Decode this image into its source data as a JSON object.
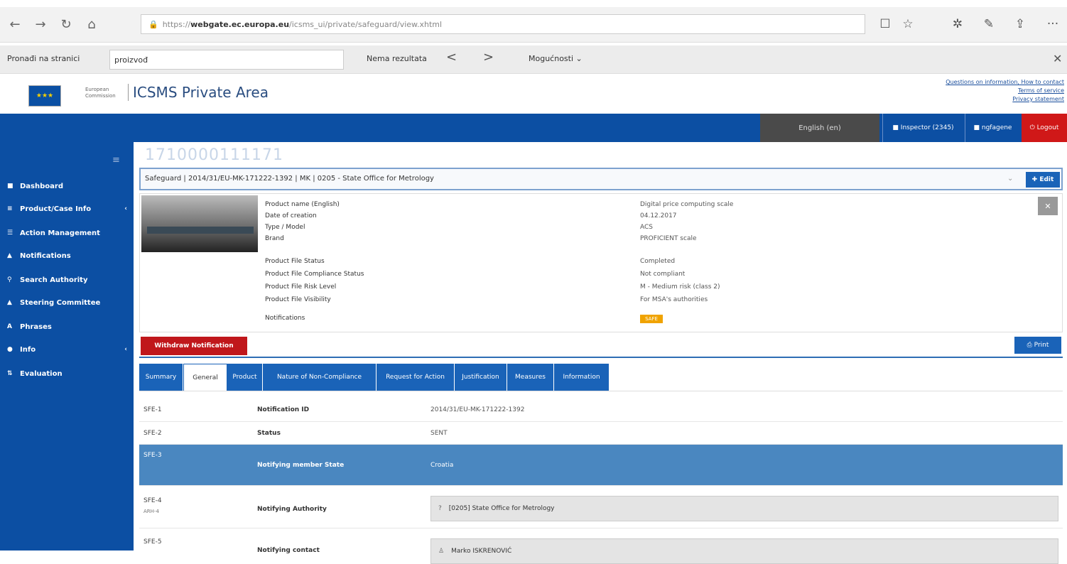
{
  "browser": {
    "back": "←",
    "forward": "→",
    "refresh": "↻",
    "home": "⌂",
    "url_prefix": "https://",
    "url_domain": "webgate.ec.europa.eu",
    "url_rest": "/icsms_ui/private/safeguard/view.xhtml",
    "reading_view": "☐",
    "favorite": "☆",
    "favorites_list": "✲",
    "notes": "✎",
    "share": "⇪",
    "more": "···"
  },
  "findbar": {
    "label": "Pronađi na stranici",
    "query": "proizvođ",
    "result": "Nema rezultata",
    "prev": "<",
    "next": ">",
    "options": "Mogućnosti ⌄",
    "close": "✕"
  },
  "header": {
    "ec_text": "European Commission",
    "title": "ICSMS Private Area",
    "links": [
      "Questions on information, How to contact",
      "Terms of service",
      "Privacy statement"
    ]
  },
  "topnav": {
    "language": "English (en)",
    "org": "■ Inspector (2345)",
    "user": "■ ngfagene",
    "logout": "⏻ Logout"
  },
  "sidebar": {
    "toggle": "≡",
    "items": [
      {
        "icon": "■",
        "label": "Dashboard",
        "chevron": ""
      },
      {
        "icon": "≡",
        "label": "Product/Case Info",
        "chevron": "‹"
      },
      {
        "icon": "☰",
        "label": "Action Management",
        "chevron": ""
      },
      {
        "icon": "▲",
        "label": "Notifications",
        "chevron": ""
      },
      {
        "icon": "⚲",
        "label": "Search Authority",
        "chevron": ""
      },
      {
        "icon": "▲",
        "label": "Steering Committee",
        "chevron": ""
      },
      {
        "icon": "A",
        "label": "Phrases",
        "chevron": ""
      },
      {
        "icon": "●",
        "label": "Info",
        "chevron": "‹"
      },
      {
        "icon": "⇅",
        "label": "Evaluation",
        "chevron": ""
      }
    ]
  },
  "record": {
    "id": "1710000111171",
    "headline": "Safeguard | 2014/31/EU-MK-171222-1392 | MK | 0205 - State Office for Metrology",
    "headline_dd": "⌄",
    "edit_button": "✚ Edit",
    "labels": [
      "Product name (English)",
      "Date of creation",
      "Type / Model",
      "Brand",
      "Product File Status",
      "Product File Compliance Status",
      "Product File Risk Level",
      "Product File Visibility",
      "Notifications"
    ],
    "values": [
      "Digital price computing scale",
      "04.12.2017",
      "ACS",
      "PROFICIENT scale",
      "Completed",
      "Not compliant",
      "M - Medium risk (class 2)",
      "For MSA's authorities",
      ""
    ],
    "badge": "SAFE",
    "close": "✕"
  },
  "actions": {
    "withdraw": "Withdraw Notification",
    "print": "⎙ Print"
  },
  "tabs": [
    "Summary",
    "General",
    "Product",
    "Nature of Non-Compliance",
    "Request for Action",
    "Justification",
    "Measures",
    "Information"
  ],
  "rows": [
    {
      "code": "SFE-1",
      "sub": "",
      "label": "Notification ID",
      "value": "2014/31/EU-MK-171222-1392"
    },
    {
      "code": "SFE-2",
      "sub": "",
      "label": "Status",
      "value": "SENT"
    },
    {
      "code": "SFE-3",
      "sub": "",
      "label": "Notifying member State",
      "value": "Croatia"
    },
    {
      "code": "SFE-4",
      "sub": "ARH-4",
      "label": "Notifying Authority",
      "value": "[0205] State Office for Metrology"
    },
    {
      "code": "SFE-5",
      "sub": "",
      "label": "Notifying contact",
      "value": "Marko ISKRENOVIĆ"
    }
  ]
}
